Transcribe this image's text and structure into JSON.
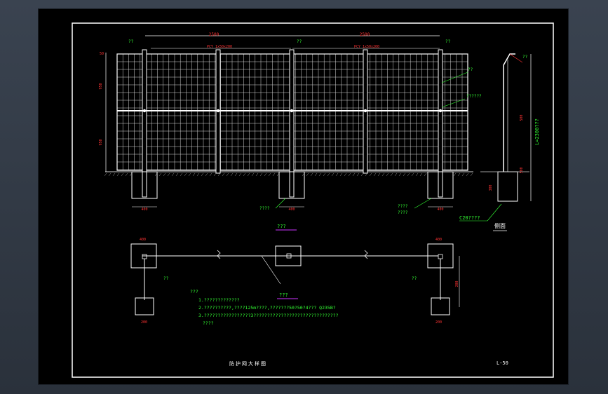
{
  "drawing": {
    "dims": {
      "span_left": "2500",
      "span_right": "2500",
      "mesh_spec_left": "PCY 1x50x200",
      "mesh_spec_right": "PCY 1x50x200",
      "height_upper": "950",
      "height_lower": "950",
      "height_total": "50",
      "footing_w": "400",
      "plan_dim_1": "400",
      "plan_dim_2": "400",
      "plan_dim_3": "200",
      "plan_dim_4": "200",
      "side_dim_1": "500",
      "side_dim_2": "500",
      "side_dim_3": "300",
      "side_dim_4": "200",
      "side_dim_5": "180"
    },
    "labels": {
      "tag_a": "??",
      "tag_b": "??",
      "tag_c": "??",
      "side_tag": "??",
      "mesh_tag": "??",
      "wire_tag": "??????",
      "post_tag": "????",
      "found_tag_1": "????",
      "found_tag_2": "????",
      "concrete_tag": "C20????",
      "side_section": "L=2300???",
      "section_title": "侧面",
      "plan_title_1": "???",
      "plan_title_2": "???",
      "plan_tag": "??"
    },
    "notes": {
      "heading": "???",
      "line1": "1.?????????????",
      "line2": "2.??????????,????125m????,???????50?50?4???  Q235B?",
      "line3": "3.?????????????????3???????????????????????????????",
      "line4": "????"
    },
    "title_block": {
      "drawing_title": "防护网大样图",
      "sheet_no": "L-50"
    },
    "colors": {
      "sheet_bg": "#000000",
      "frame": "#ffffff",
      "notes_green": "#33ff33",
      "dim_green": "#00ff66",
      "accent_magenta": "#cc33ff"
    }
  }
}
